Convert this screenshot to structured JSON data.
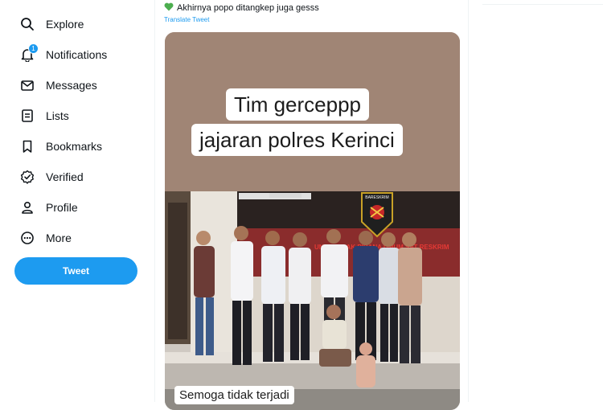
{
  "sidebar": {
    "items": [
      {
        "label": "Explore",
        "icon": "search-icon"
      },
      {
        "label": "Notifications",
        "icon": "bell-icon",
        "badge": "1"
      },
      {
        "label": "Messages",
        "icon": "envelope-icon"
      },
      {
        "label": "Lists",
        "icon": "list-icon"
      },
      {
        "label": "Bookmarks",
        "icon": "bookmark-icon"
      },
      {
        "label": "Verified",
        "icon": "verified-icon"
      },
      {
        "label": "Profile",
        "icon": "person-icon"
      },
      {
        "label": "More",
        "icon": "more-circle-icon"
      }
    ],
    "tweet_button": "Tweet"
  },
  "tweet": {
    "text": "Akhirnya popo ditangkep juga gesss",
    "emoji": "green-heart-icon",
    "translate_link": "Translate Tweet",
    "media": {
      "caption_line1": "Tim gerceppp",
      "caption_line2": "jajaran polres Kerinci",
      "caption_bottom": "Semoga tidak terjadi",
      "wall_sign": "UNIT TINDAK PIDANA UMUM SAT RESKRIM",
      "logo_text": "BARESKRIM"
    }
  },
  "colors": {
    "accent": "#1d9bf0",
    "caption_bg": "#a08575",
    "text": "#0f1419"
  }
}
